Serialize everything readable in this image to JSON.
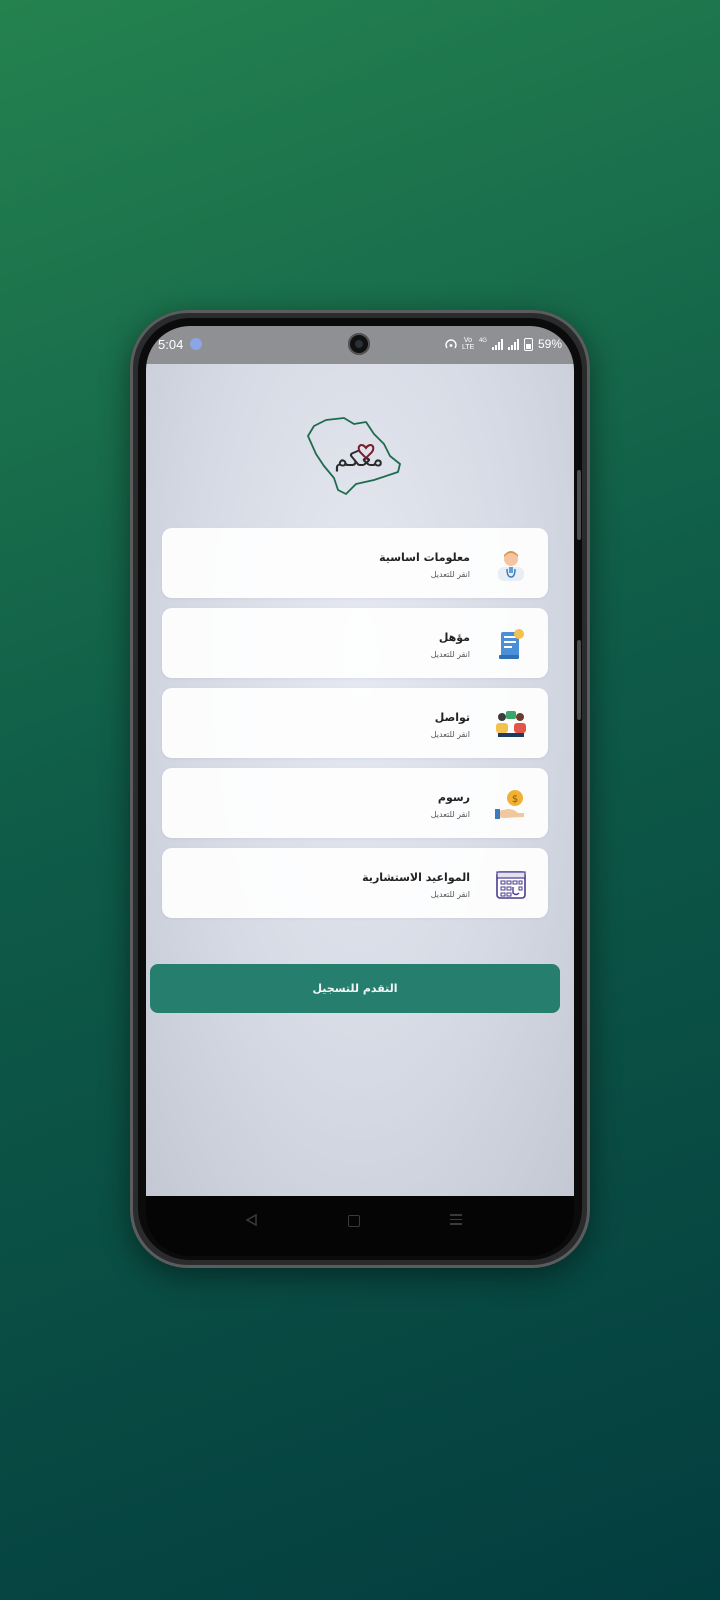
{
  "status_bar": {
    "time": "5:04",
    "network": "Vo LTE",
    "network_gen": "4G",
    "battery": "59%"
  },
  "logo": {
    "text": "معكم",
    "accent_color": "#7a1e2b",
    "outline_color": "#1e6b4e"
  },
  "cards": [
    {
      "title": "معلومات اساسية",
      "subtitle": "انقر للتعديل",
      "icon": "doctor-icon"
    },
    {
      "title": "مؤهل",
      "subtitle": "انقر للتعديل",
      "icon": "certificate-icon"
    },
    {
      "title": "تواصل",
      "subtitle": "انقر للتعديل",
      "icon": "communication-icon"
    },
    {
      "title": "رسوم",
      "subtitle": "انقر للتعديل",
      "icon": "fees-coin-icon"
    },
    {
      "title": "المواعيد الاستشارية",
      "subtitle": "انقر للتعديل",
      "icon": "calendar-icon"
    }
  ],
  "cta": {
    "label": "التقدم للتسجيل",
    "color": "#257e6e"
  },
  "nav": {
    "back": "back-icon",
    "home": "home-icon",
    "menu": "menu-icon"
  }
}
